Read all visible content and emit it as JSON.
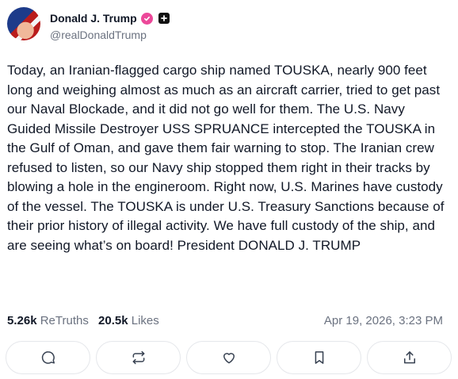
{
  "author": {
    "display_name": "Donald J. Trump",
    "handle": "@realDonaldTrump",
    "avatar_icon": "profile-photo",
    "verified_icon": "verified-check-icon",
    "plus_icon": "plus-badge-icon",
    "verified_color": "#ec4899"
  },
  "post": {
    "text": "Today, an Iranian-flagged cargo ship named TOUSKA, nearly 900 feet long and weighing almost as much as an aircraft carrier, tried to get past our Naval Blockade, and it did not go well for them. The U.S. Navy Guided Missile Destroyer USS SPRUANCE intercepted the TOUSKA in the Gulf of Oman, and gave them fair warning to stop. The Iranian crew refused to listen, so our Navy ship stopped them right in their tracks by blowing a hole in the engineroom. Right now, U.S. Marines have custody of the vessel. The TOUSKA is under U.S. Treasury Sanctions because of their prior history of illegal activity. We have full custody of the ship, and are seeing what’s on board! President DONALD J. TRUMP"
  },
  "stats": {
    "retruths_count": "5.26k",
    "retruths_label": "ReTruths",
    "likes_count": "20.5k",
    "likes_label": "Likes",
    "timestamp": "Apr 19, 2026, 3:23 PM"
  },
  "actions": [
    {
      "name": "reply",
      "icon": "comment-icon"
    },
    {
      "name": "retruth",
      "icon": "repost-icon"
    },
    {
      "name": "like",
      "icon": "heart-icon"
    },
    {
      "name": "bookmark",
      "icon": "bookmark-icon"
    },
    {
      "name": "share",
      "icon": "share-icon"
    }
  ]
}
